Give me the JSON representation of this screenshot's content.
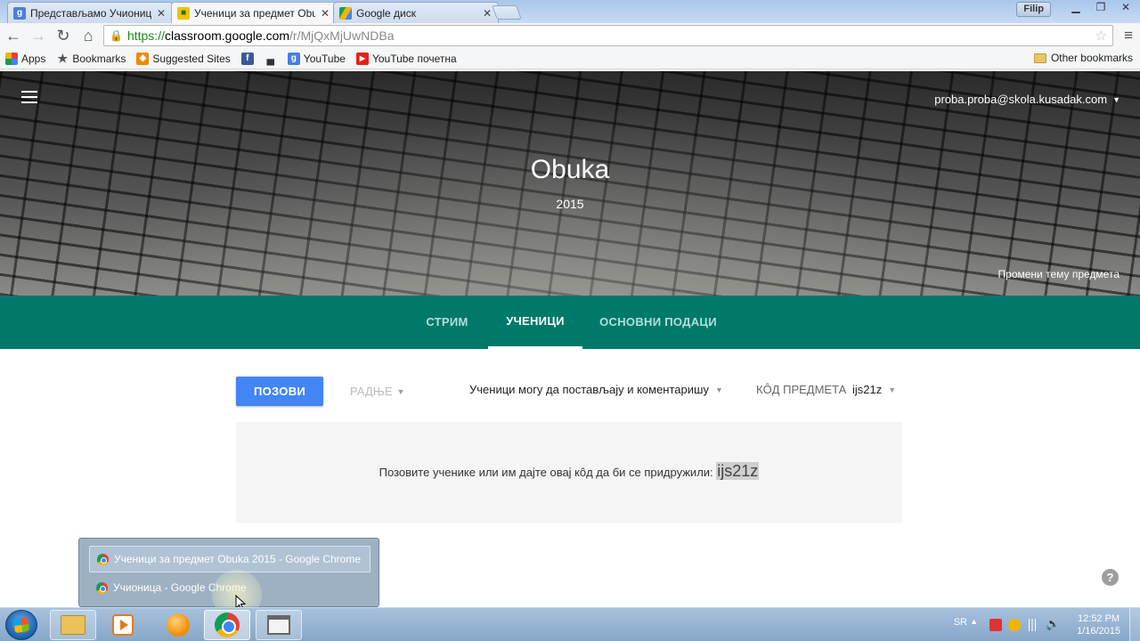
{
  "browser": {
    "tabs": [
      {
        "title": "Представљамо Учионицу",
        "favicon": "google-g-icon",
        "active": false
      },
      {
        "title": "Ученици за предмет Obuka",
        "favicon": "classroom-icon",
        "active": true
      },
      {
        "title": "Google диск",
        "favicon": "drive-icon",
        "active": false
      }
    ],
    "close_glyph": "✕",
    "user": "Filip",
    "url": {
      "scheme": "https://",
      "host": "classroom.google.com",
      "path": "/r/MjQxMjUwNDBa"
    },
    "bookmarks": [
      {
        "label": "Apps",
        "icon": "apps-grid-icon"
      },
      {
        "label": "Bookmarks",
        "icon": "star-icon"
      },
      {
        "label": "Suggested Sites",
        "icon": "suggested-sites-icon"
      },
      {
        "label": "",
        "icon": "facebook-icon"
      },
      {
        "label": "",
        "icon": "bookmark-car-icon"
      },
      {
        "label": "YouTube",
        "icon": "google-g-icon"
      },
      {
        "label": "YouTube почетна",
        "icon": "youtube-icon"
      }
    ],
    "other_bookmarks": "Other bookmarks"
  },
  "header": {
    "account": "proba.proba@skola.kusadak.com",
    "class_name": "Obuka",
    "section": "2015",
    "change_theme": "Промени тему предмета"
  },
  "class_tabs": [
    {
      "label": "СТРИМ",
      "active": false
    },
    {
      "label": "УЧЕНИЦИ",
      "active": true
    },
    {
      "label": "ОСНОВНИ ПОДАЦИ",
      "active": false
    }
  ],
  "students": {
    "invite_button": "ПОЗОВИ",
    "actions_dropdown": "РАДЊЕ",
    "permission_dropdown": "Ученици могу да постављају и коментаришу",
    "class_code_label": "КÔД ПРЕДМЕТА",
    "class_code": "ijs21z",
    "invite_message": "Позовите ученике или им дајте овај кôд да би се придружили:",
    "invite_code": "ijs21z",
    "help": "?"
  },
  "taskbar_popup": {
    "items": [
      {
        "label": "Ученици за предмет Obuka 2015 - Google Chrome",
        "selected": true
      },
      {
        "label": "Учионица - Google Chrome",
        "selected": false
      }
    ]
  },
  "taskbar": {
    "language": "SR",
    "time": "12:52 PM",
    "date": "1/16/2015"
  },
  "colors": {
    "teal_tabs": "#00796b",
    "invite_blue": "#4285f4"
  }
}
